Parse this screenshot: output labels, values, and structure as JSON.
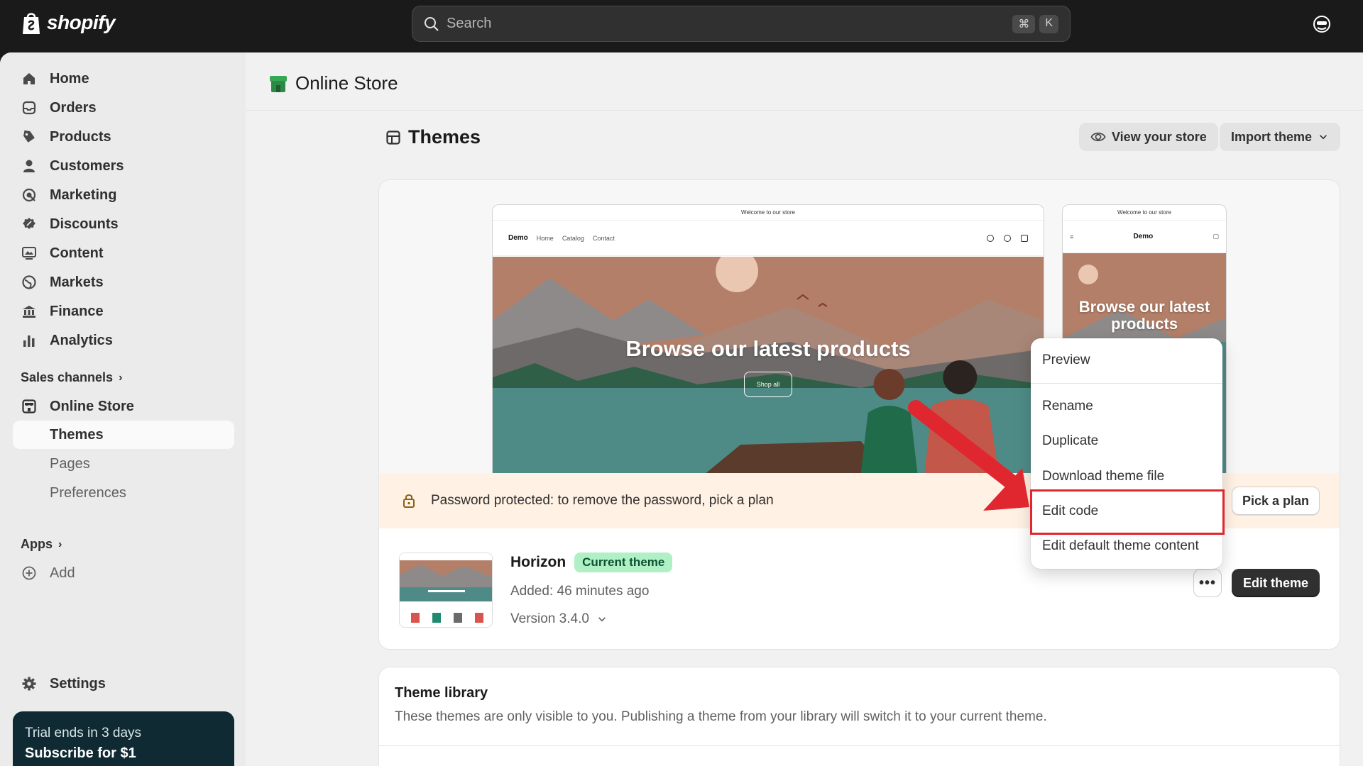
{
  "topbar": {
    "brand": "shopify",
    "search_placeholder": "Search",
    "shortcut_key1": "⌘",
    "shortcut_key2": "K"
  },
  "sidebar": {
    "items": [
      {
        "label": "Home",
        "icon": "home-icon"
      },
      {
        "label": "Orders",
        "icon": "inbox-icon"
      },
      {
        "label": "Products",
        "icon": "tag-icon"
      },
      {
        "label": "Customers",
        "icon": "person-icon"
      },
      {
        "label": "Marketing",
        "icon": "target-icon"
      },
      {
        "label": "Discounts",
        "icon": "discount-icon"
      },
      {
        "label": "Content",
        "icon": "content-icon"
      },
      {
        "label": "Markets",
        "icon": "globe-icon"
      },
      {
        "label": "Finance",
        "icon": "bank-icon"
      },
      {
        "label": "Analytics",
        "icon": "bar-chart-icon"
      }
    ],
    "sales_channels_label": "Sales channels",
    "online_store_label": "Online Store",
    "sub_items": [
      "Themes",
      "Pages",
      "Preferences"
    ],
    "apps_label": "Apps",
    "add_label": "Add",
    "settings_label": "Settings",
    "trial_text": "Trial ends in 3 days",
    "trial_cta": "Subscribe for $1"
  },
  "header": {
    "title": "Online Store"
  },
  "themes": {
    "title": "Themes",
    "view_store": "View your store",
    "import_theme": "Import theme",
    "preview": {
      "announcement": "Welcome to our store",
      "brand": "Demo",
      "nav": [
        "Home",
        "Catalog",
        "Contact"
      ],
      "hero_text": "Browse our latest products",
      "hero_button": "Shop all",
      "mobile_hero_text": "Browse our latest products"
    },
    "banner_text": "Password protected: to remove the password, pick a plan",
    "pick_plan": "Pick a plan",
    "current": {
      "name": "Horizon",
      "badge": "Current theme",
      "added": "Added: 46 minutes ago",
      "version": "Version 3.4.0",
      "more": "•••",
      "edit_button": "Edit theme"
    }
  },
  "menu": {
    "items": [
      "Preview",
      "Rename",
      "Duplicate",
      "Download theme file",
      "Edit code",
      "Edit default theme content"
    ]
  },
  "library": {
    "title": "Theme library",
    "subtitle": "These themes are only visible to you. Publishing a theme from your library will switch it to your current theme."
  },
  "colors": {
    "accent_red": "#e0262f",
    "badge_green": "#aff0c4",
    "banner_bg": "#fff1e3",
    "topbar_bg": "#1a1a1a"
  }
}
